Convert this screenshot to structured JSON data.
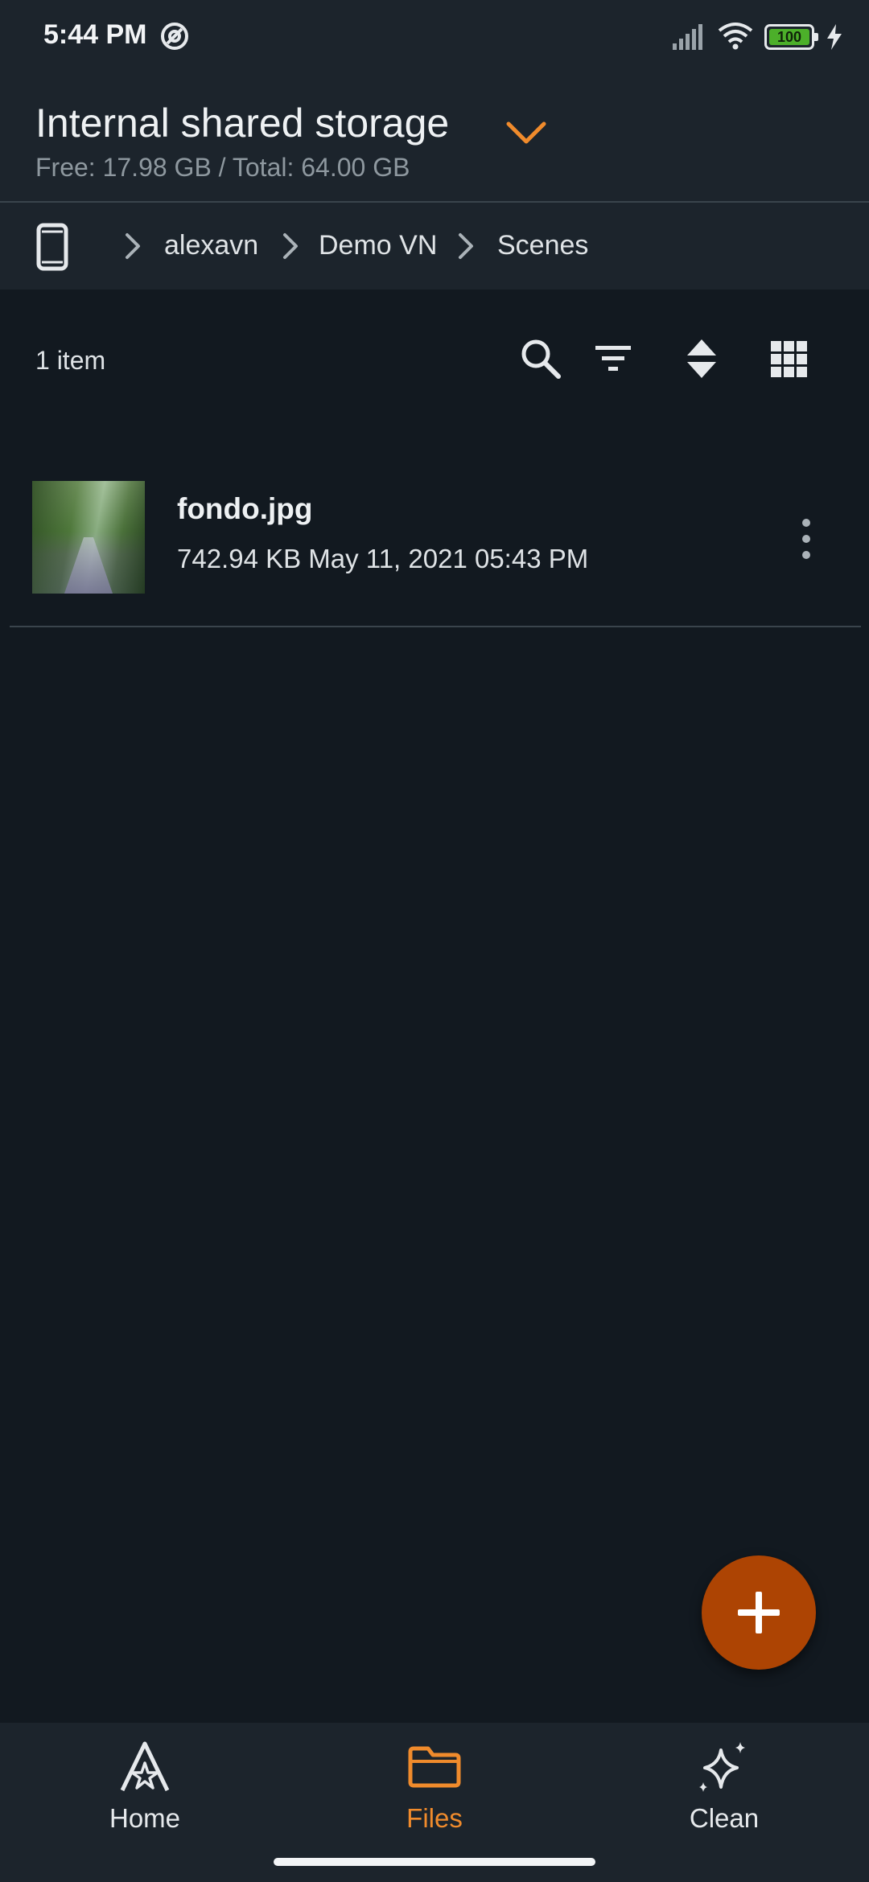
{
  "status_bar": {
    "time": "5:44 PM",
    "battery_level": "100",
    "icons": [
      "do-not-disturb-icon",
      "signal-icon",
      "wifi-icon",
      "battery-icon",
      "charging-icon"
    ]
  },
  "storage": {
    "title": "Internal shared storage",
    "subtitle": "Free: 17.98 GB / Total: 64.00 GB"
  },
  "breadcrumb": {
    "items": [
      {
        "label": "alexavn"
      },
      {
        "label": "Demo VN"
      },
      {
        "label": "Scenes"
      }
    ]
  },
  "toolbar": {
    "item_count": "1 item",
    "icons": [
      "search-icon",
      "filter-icon",
      "sort-icon",
      "grid-view-icon"
    ]
  },
  "files": [
    {
      "name": "fondo.jpg",
      "meta": "742.94 KB May 11, 2021 05:43 PM"
    }
  ],
  "bottom_nav": {
    "items": [
      {
        "label": "Home",
        "icon": "home-icon",
        "active": false
      },
      {
        "label": "Files",
        "icon": "folder-icon",
        "active": true
      },
      {
        "label": "Clean",
        "icon": "sparkle-icon",
        "active": false
      }
    ]
  },
  "colors": {
    "accent": "#f08b2c",
    "fab": "#ad4403",
    "background": "#121920",
    "surface": "#1c242c"
  }
}
